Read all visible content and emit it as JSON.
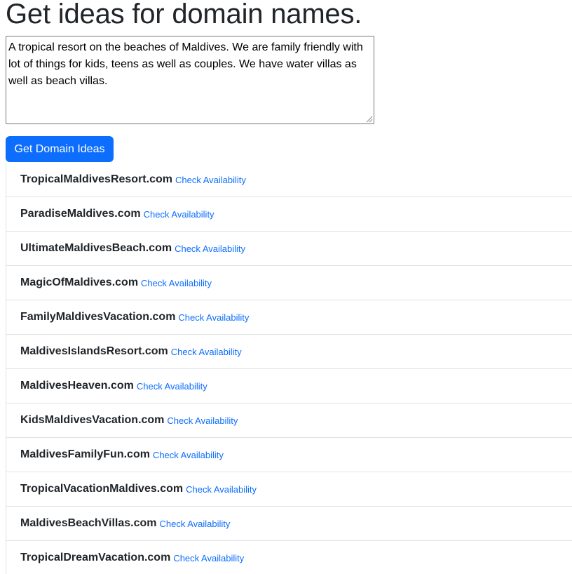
{
  "title": "Get ideas for domain names.",
  "description": "A tropical resort on the beaches of Maldives. We are family friendly with lot of things for kids, teens as well as couples. We have water villas as well as beach villas.",
  "button_label": "Get Domain Ideas",
  "check_label": "Check Availability",
  "domains": [
    "TropicalMaldivesResort.com",
    "ParadiseMaldives.com",
    "UltimateMaldivesBeach.com",
    "MagicOfMaldives.com",
    "FamilyMaldivesVacation.com",
    "MaldivesIslandsResort.com",
    "MaldivesHeaven.com",
    "KidsMaldivesVacation.com",
    "MaldivesFamilyFun.com",
    "TropicalVacationMaldives.com",
    "MaldivesBeachVillas.com",
    "TropicalDreamVacation.com"
  ],
  "colors": {
    "primary": "#0d6efd",
    "text": "#212529",
    "border": "#dee2e6"
  }
}
